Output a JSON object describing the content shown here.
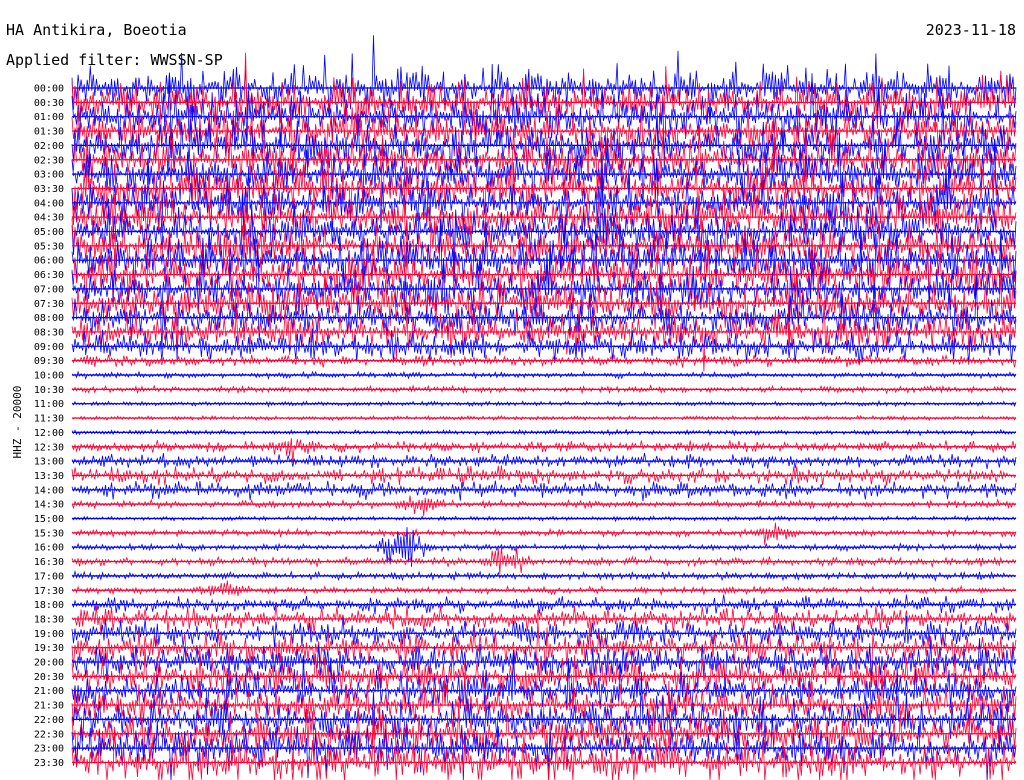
{
  "header": {
    "station": "HA Antikira, Boeotia",
    "filter": "Applied filter: WWSSN-SP",
    "date": "2023-11-18"
  },
  "y_axis_label": "HHZ - 20000",
  "colors": {
    "even_rows": "#0000ff",
    "odd_rows": "#ff0033",
    "text": "#000000"
  },
  "chart_data": {
    "type": "line",
    "title": "HA Antikira, Boeotia",
    "subtitle": "Applied filter: WWSSN-SP",
    "ylabel": "HHZ - 20000",
    "date": "2023-11-18",
    "row_labels": [
      "00:00",
      "00:30",
      "01:00",
      "01:30",
      "02:00",
      "02:30",
      "03:00",
      "03:30",
      "04:00",
      "04:30",
      "05:00",
      "05:30",
      "06:00",
      "06:30",
      "07:00",
      "07:30",
      "08:00",
      "08:30",
      "09:00",
      "09:30",
      "10:00",
      "10:30",
      "11:00",
      "11:30",
      "12:00",
      "12:30",
      "13:00",
      "13:30",
      "14:00",
      "14:30",
      "15:00",
      "15:30",
      "16:00",
      "16:30",
      "17:00",
      "17:30",
      "18:00",
      "18:30",
      "19:00",
      "19:30",
      "20:00",
      "20:30",
      "21:00",
      "21:30",
      "22:00",
      "22:30",
      "23:00",
      "23:30"
    ],
    "row_activity": [
      0.9,
      0.95,
      0.95,
      0.9,
      0.95,
      0.95,
      0.95,
      0.95,
      0.95,
      0.95,
      0.9,
      0.9,
      0.95,
      0.95,
      0.95,
      0.9,
      0.8,
      0.75,
      0.6,
      0.2,
      0.08,
      0.1,
      0.05,
      0.04,
      0.06,
      0.2,
      0.25,
      0.35,
      0.35,
      0.12,
      0.05,
      0.1,
      0.1,
      0.15,
      0.12,
      0.1,
      0.3,
      0.5,
      0.55,
      0.65,
      0.7,
      0.75,
      0.75,
      0.8,
      0.8,
      0.85,
      0.85,
      0.9
    ],
    "events": [
      {
        "row": 10,
        "x_frac": 0.55,
        "amp": 0.6
      },
      {
        "row": 11,
        "x_frac": 0.18,
        "amp": 0.7
      },
      {
        "row": 25,
        "x_frac": 0.23,
        "amp": 0.9
      },
      {
        "row": 29,
        "x_frac": 0.37,
        "amp": 0.8
      },
      {
        "row": 31,
        "x_frac": 0.742,
        "amp": 0.8
      },
      {
        "row": 32,
        "x_frac": 0.35,
        "amp": 2.2
      },
      {
        "row": 33,
        "x_frac": 0.46,
        "amp": 1.3
      },
      {
        "row": 35,
        "x_frac": 0.16,
        "amp": 0.9
      }
    ]
  }
}
